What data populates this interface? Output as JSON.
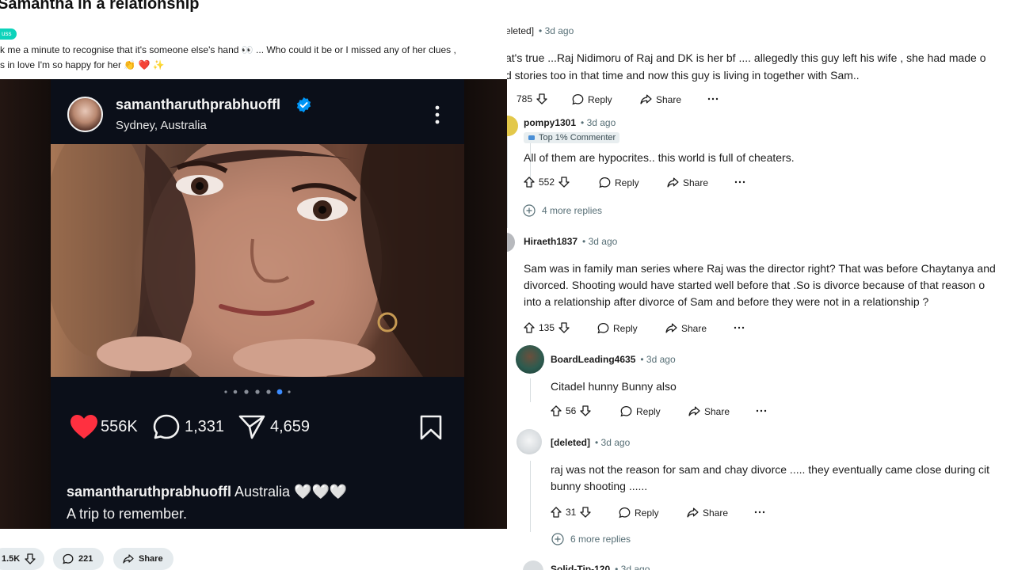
{
  "post": {
    "title": "Samantha in a relationship",
    "flair": "uss",
    "body_line1": "k me a minute to recognise that it's someone else's hand 👀 ... Who could it be or I missed any of her clues ,",
    "body_line2": "s in love I'm so happy for her 👏 ❤️ ✨"
  },
  "instagram": {
    "username": "samantharuthprabhuoffl",
    "location": "Sydney, Australia",
    "likes": "556K",
    "comments": "1,331",
    "shares": "4,659",
    "caption_user": "samantharuthprabhuoffl",
    "caption_text": " Australia 🤍🤍🤍",
    "caption_line2": "A trip to remember."
  },
  "post_actions": {
    "votes": "1.5K",
    "comments": "221",
    "share": "Share"
  },
  "comments": [
    {
      "user": "eleted]",
      "time": "• 3d ago",
      "lines": [
        "at's true ...Raj Nidimoru of Raj and DK is her bf .... allegedly this guy left his wife , she had made o",
        "d stories too in that time and now this guy is living in together with Sam.."
      ],
      "votes": "785",
      "reply": "Reply",
      "share": "Share"
    },
    {
      "user": "pompy1301",
      "time": "• 3d ago",
      "badge": "Top 1% Commenter",
      "lines": [
        "All of them are hypocrites.. this world is full of cheaters."
      ],
      "votes": "552",
      "reply": "Reply",
      "share": "Share",
      "more_replies": "4 more replies"
    },
    {
      "user": "Hiraeth1837",
      "time": "• 3d ago",
      "lines": [
        "Sam was in family man series where Raj was the director right? That was before Chaytanya and",
        "divorced. Shooting would have started well before that .So is divorce because of that reason o",
        "into a relationship after divorce of Sam and before they were not in a relationship ?"
      ],
      "votes": "135",
      "reply": "Reply",
      "share": "Share"
    },
    {
      "user": "BoardLeading4635",
      "time": "• 3d ago",
      "lines": [
        "Citadel hunny Bunny also"
      ],
      "votes": "56",
      "reply": "Reply",
      "share": "Share"
    },
    {
      "user": "[deleted]",
      "time": "• 3d ago",
      "lines": [
        "raj was not the reason for sam and chay divorce ..... they eventually came close during cit",
        "bunny shooting ......"
      ],
      "votes": "31",
      "reply": "Reply",
      "share": "Share",
      "more_replies": "6 more replies"
    },
    {
      "user": "Solid-Tip-120",
      "time": "• 3d ago"
    }
  ],
  "colors": {
    "accent_flair": "#0dd3bb",
    "like_heart": "#ff3040",
    "verified_blue": "#0095f6",
    "card_bg": "#0b0f19"
  },
  "icons": [
    "verified-badge-icon",
    "more-vertical-icon",
    "heart-icon",
    "comment-bubble-icon",
    "send-icon",
    "bookmark-icon",
    "upvote-icon",
    "downvote-icon",
    "reply-icon",
    "share-icon",
    "overflow-dots-icon",
    "expand-plus-icon"
  ]
}
